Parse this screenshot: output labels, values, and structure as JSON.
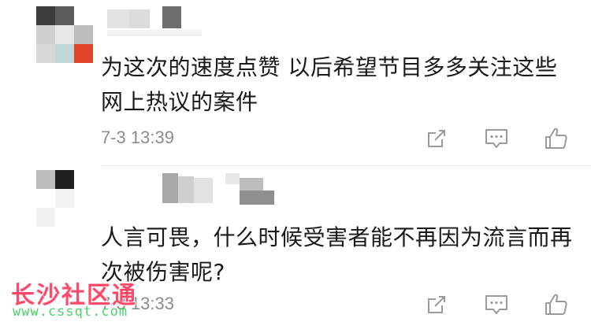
{
  "comments": [
    {
      "text": "为这次的速度点赞 以后希望节目多多关注这些网上热议的案件",
      "time": "7-3 13:39"
    },
    {
      "text": "人言可畏，什么时候受害者能不再因为流言而再次被伤害呢?",
      "time": "7-3 13:33"
    }
  ],
  "watermark": {
    "title": "长沙社区通",
    "url": "www.cssqt.com"
  },
  "colors": {
    "text": "#1a1a1a",
    "meta": "#8c8c8c",
    "icon": "#9a9a9a",
    "divider": "#e6e6e6",
    "watermark_title": "#ff4a6a",
    "watermark_url": "#4cd36a"
  },
  "icons": {
    "share": "share-icon",
    "reply": "comment-icon",
    "like": "thumbs-up-icon"
  }
}
